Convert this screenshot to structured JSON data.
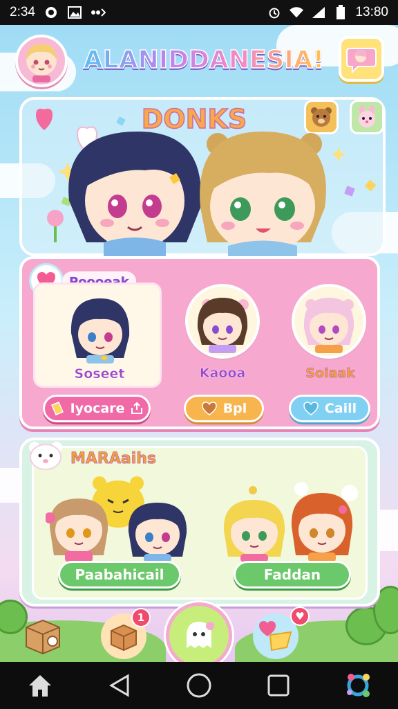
{
  "status_bar": {
    "time_left": "2:34",
    "time_right": "13:80",
    "icons": [
      "whatsapp-icon",
      "image-icon",
      "signal-dots-icon",
      "alarm-icon",
      "wifi-icon",
      "cell-signal-icon",
      "battery-icon"
    ]
  },
  "header": {
    "title": "ALANIDDANESIA!",
    "avatar_icon": "profile-avatar",
    "chat_icon": "chat-bubble-icon"
  },
  "hero": {
    "title": "DONKS",
    "mini_icons": [
      "bear-face-icon",
      "bunny-face-icon"
    ]
  },
  "characters_panel": {
    "label": "Poooeak",
    "cards": [
      {
        "name": "Soseet"
      },
      {
        "name": "Kaooa"
      },
      {
        "name": "Soiaak"
      }
    ],
    "buttons": [
      {
        "label": "Iyocare",
        "icon": "share-icon",
        "color": "#f06aa8"
      },
      {
        "label": "Bpl",
        "icon": "heart-icon",
        "color": "#f8b54e"
      },
      {
        "label": "Caill",
        "icon": "heart-icon",
        "color": "#7fd0f2"
      }
    ]
  },
  "group_panel": {
    "title": "MARAaihs",
    "buttons": [
      {
        "label": "Paabahicail"
      },
      {
        "label": "Faddan"
      }
    ]
  },
  "dock": {
    "items": [
      {
        "icon": "camera-box-icon"
      },
      {
        "icon": "gift-box-icon",
        "badge": "1"
      },
      {
        "icon": "ghost-home-icon"
      },
      {
        "icon": "heart-chat-icon",
        "badge": "♥"
      }
    ]
  },
  "nav": {
    "buttons": [
      "home-icon",
      "back-icon",
      "circle-home-icon",
      "recents-icon",
      "assistant-icon"
    ]
  },
  "colors": {
    "pink": "#f6a8cf",
    "green": "#6cc96b",
    "sky": "#9fdcf5",
    "title_orange": "#f8a94a",
    "label_purple": "#9d48c9"
  }
}
